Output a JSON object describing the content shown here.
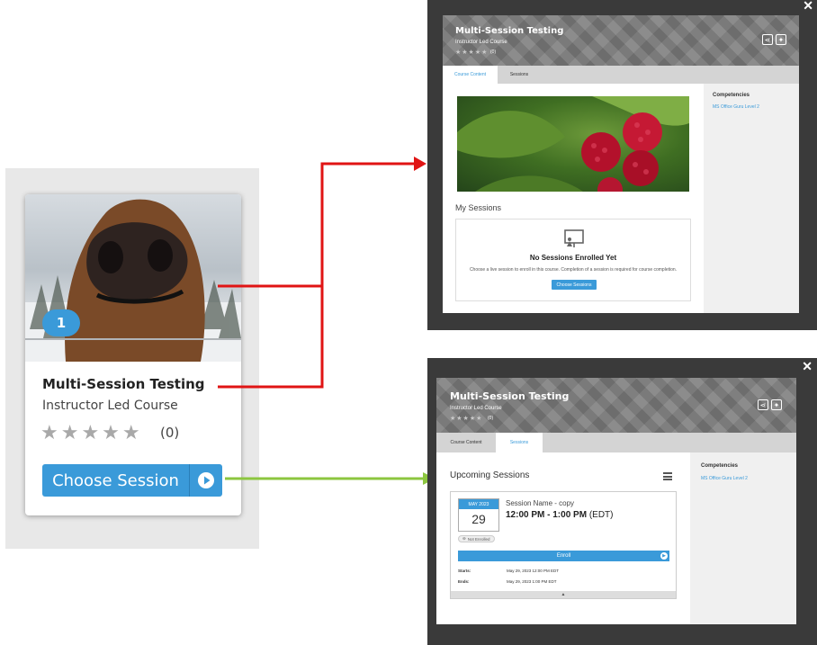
{
  "card": {
    "badge": "1",
    "title": "Multi-Session Testing",
    "subtitle": "Instructor Led Course",
    "stars": "★★★★★",
    "rating_count": "(0)",
    "button_label": "Choose Session"
  },
  "modal_top": {
    "close": "✕",
    "title": "Multi-Session Testing",
    "subtitle": "Instructor Led Course",
    "stars": "★★★★★",
    "rating_count": "(0)",
    "tabs": [
      {
        "label": "Course Content"
      },
      {
        "label": "Sessions"
      }
    ],
    "active_tab": "Course Content",
    "my_sessions_label": "My Sessions",
    "empty_title": "No Sessions Enrolled Yet",
    "empty_text": "Choose a live session to enroll in this course. Completion of a session is required for course completion.",
    "choose_btn": "Choose Sessions",
    "competencies_header": "Competencies",
    "competency": "MS Office Guru Level 2"
  },
  "modal_bottom": {
    "close": "✕",
    "title": "Multi-Session Testing",
    "subtitle": "Instructor Led Course",
    "stars": "★★★★★",
    "rating_count": "(0)",
    "tabs": [
      {
        "label": "Course Content"
      },
      {
        "label": "Sessions"
      }
    ],
    "active_tab": "Sessions",
    "upcoming_label": "Upcoming Sessions",
    "session": {
      "month": "MAY 2023",
      "day": "29",
      "name": "Session Name - copy",
      "time": "12:00 PM - 1:00 PM",
      "tz": "(EDT)",
      "status": "Not Enrolled",
      "enroll_label": "Enroll",
      "starts_label": "Starts:",
      "starts_value": "May 29, 2023 12:00 PM EDT",
      "ends_label": "Ends:",
      "ends_value": "May 29, 2023 1:00 PM EDT"
    },
    "competencies_header": "Competencies",
    "competency": "MS Office Guru Level 2"
  },
  "colors": {
    "accent": "#3a9ad9",
    "arrow_red": "#e01414",
    "arrow_green": "#8cc63f",
    "modal_frame": "#3a3a3a"
  }
}
